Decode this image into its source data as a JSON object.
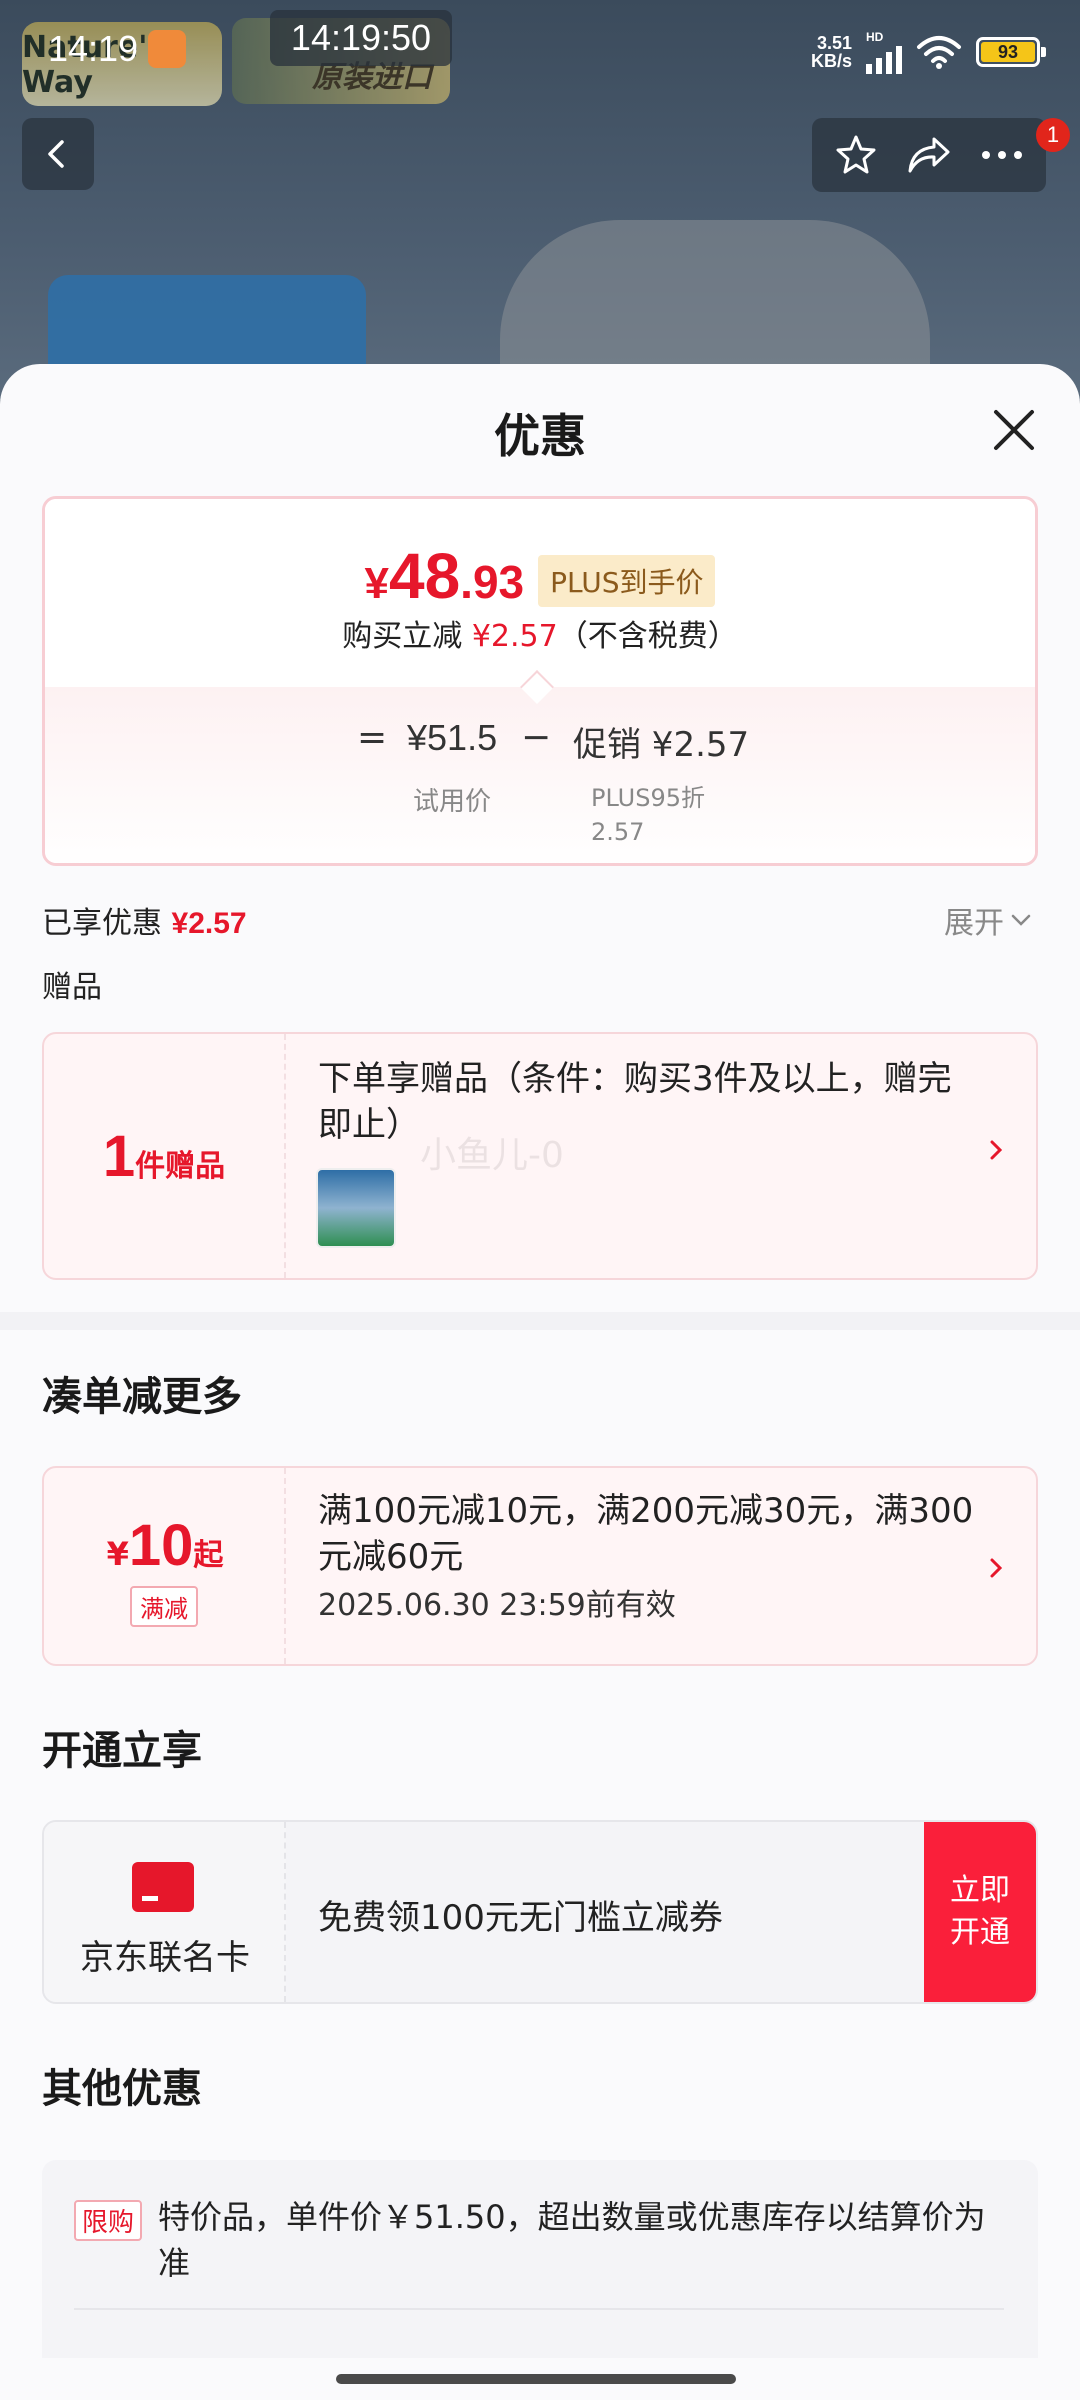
{
  "status_bar": {
    "time": "14:19",
    "clock_overlay": "14:19:50",
    "net_speed_value": "3.51",
    "net_speed_unit": "KB/s",
    "signal_label": "HD",
    "battery_level": "93"
  },
  "background": {
    "brand_logo_text": "Nature's Way",
    "seal_text": "原装进口"
  },
  "nav": {
    "message_badge": "1",
    "icons": [
      "back-icon",
      "star-icon",
      "share-icon",
      "more-icon"
    ]
  },
  "sheet": {
    "title": "优惠",
    "price": {
      "yen": "¥",
      "integer": "48",
      "decimal": ".93",
      "plus_tag": "PLUS到手价",
      "reduce_prefix": "购买立减",
      "reduce_amount": "¥2.57",
      "reduce_suffix": "（不含税费）",
      "equals": "=",
      "try_price": "¥51.5",
      "minus": "−",
      "promo": "促销 ¥2.57",
      "try_label": "试用价",
      "promo_label_1": "PLUS95折",
      "promo_label_2": "2.57"
    },
    "enjoyed_label": "已享优惠",
    "enjoyed_amount": "¥2.57",
    "expand_label": "展开",
    "gift_section_label": "赠品",
    "gift": {
      "count": "1",
      "unit": "件赠品",
      "text": "下单享赠品（条件：购买3件及以上，赠完即止）",
      "watermark": "小鱼儿-0"
    },
    "coupon_section_title": "凑单减更多",
    "coupon": {
      "yen": "¥",
      "amount": "10",
      "suffix": "起",
      "type": "满减",
      "text": "满100元减10元，满200元减30元，满300元减60元",
      "valid": "2025.06.30 23:59前有效"
    },
    "open_section_title": "开通立享",
    "open": {
      "card_name": "京东联名卡",
      "text": "免费领100元无门槛立减券",
      "button": "立即开通"
    },
    "other_section_title": "其他优惠",
    "other": {
      "tag": "限购",
      "text": "特价品，单件价￥51.50，超出数量或优惠库存以结算价为准"
    }
  },
  "colors": {
    "accent_red": "#e6172b",
    "button_red": "#fa1f3a",
    "plus_tag_bg": "#fbebc9"
  }
}
